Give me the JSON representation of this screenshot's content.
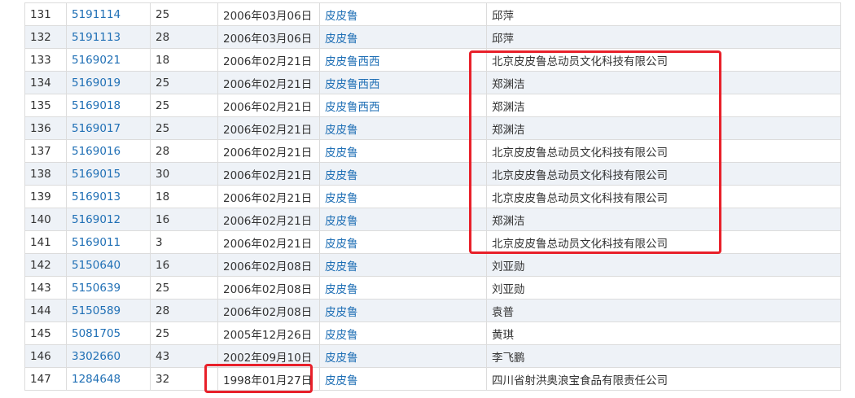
{
  "accent_link_color": "#1f6fb5",
  "highlight_color": "#e8202a",
  "rows": [
    {
      "idx": "131",
      "reg": "5191114",
      "cls": "25",
      "date": "2006年03月06日",
      "name": "皮皮鲁",
      "applicant": "邱萍"
    },
    {
      "idx": "132",
      "reg": "5191113",
      "cls": "28",
      "date": "2006年03月06日",
      "name": "皮皮鲁",
      "applicant": "邱萍"
    },
    {
      "idx": "133",
      "reg": "5169021",
      "cls": "18",
      "date": "2006年02月21日",
      "name": "皮皮鲁西西",
      "applicant": "北京皮皮鲁总动员文化科技有限公司"
    },
    {
      "idx": "134",
      "reg": "5169019",
      "cls": "25",
      "date": "2006年02月21日",
      "name": "皮皮鲁西西",
      "applicant": "郑渊洁"
    },
    {
      "idx": "135",
      "reg": "5169018",
      "cls": "25",
      "date": "2006年02月21日",
      "name": "皮皮鲁西西",
      "applicant": "郑渊洁"
    },
    {
      "idx": "136",
      "reg": "5169017",
      "cls": "25",
      "date": "2006年02月21日",
      "name": "皮皮鲁",
      "applicant": "郑渊洁"
    },
    {
      "idx": "137",
      "reg": "5169016",
      "cls": "28",
      "date": "2006年02月21日",
      "name": "皮皮鲁",
      "applicant": "北京皮皮鲁总动员文化科技有限公司"
    },
    {
      "idx": "138",
      "reg": "5169015",
      "cls": "30",
      "date": "2006年02月21日",
      "name": "皮皮鲁",
      "applicant": "北京皮皮鲁总动员文化科技有限公司"
    },
    {
      "idx": "139",
      "reg": "5169013",
      "cls": "18",
      "date": "2006年02月21日",
      "name": "皮皮鲁",
      "applicant": "北京皮皮鲁总动员文化科技有限公司"
    },
    {
      "idx": "140",
      "reg": "5169012",
      "cls": "16",
      "date": "2006年02月21日",
      "name": "皮皮鲁",
      "applicant": "郑渊洁"
    },
    {
      "idx": "141",
      "reg": "5169011",
      "cls": "3",
      "date": "2006年02月21日",
      "name": "皮皮鲁",
      "applicant": "北京皮皮鲁总动员文化科技有限公司"
    },
    {
      "idx": "142",
      "reg": "5150640",
      "cls": "16",
      "date": "2006年02月08日",
      "name": "皮皮鲁",
      "applicant": "刘亚勋"
    },
    {
      "idx": "143",
      "reg": "5150639",
      "cls": "25",
      "date": "2006年02月08日",
      "name": "皮皮鲁",
      "applicant": "刘亚勋"
    },
    {
      "idx": "144",
      "reg": "5150589",
      "cls": "28",
      "date": "2006年02月08日",
      "name": "皮皮鲁",
      "applicant": "袁普"
    },
    {
      "idx": "145",
      "reg": "5081705",
      "cls": "25",
      "date": "2005年12月26日",
      "name": "皮皮鲁",
      "applicant": "黄琪"
    },
    {
      "idx": "146",
      "reg": "3302660",
      "cls": "43",
      "date": "2002年09月10日",
      "name": "皮皮鲁",
      "applicant": "李飞鹏"
    },
    {
      "idx": "147",
      "reg": "1284648",
      "cls": "32",
      "date": "1998年01月27日",
      "name": "皮皮鲁",
      "applicant": "四川省射洪奥浪宝食品有限责任公司"
    }
  ]
}
